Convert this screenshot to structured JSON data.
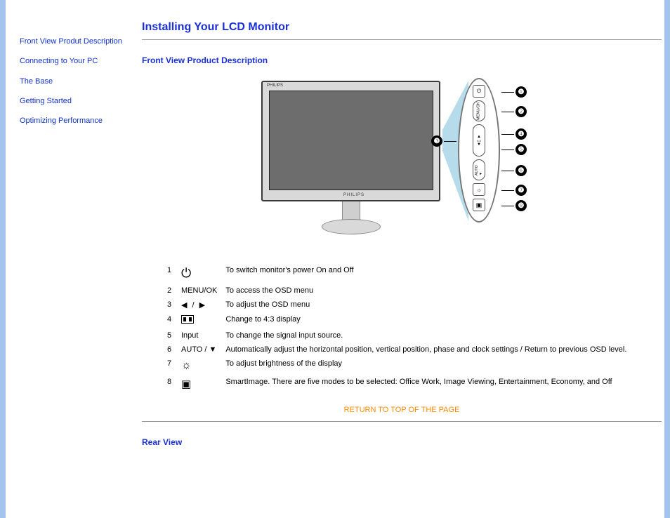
{
  "sidebar": {
    "items": [
      {
        "label": "Front View Produt Description"
      },
      {
        "label": "Connecting to Your PC"
      },
      {
        "label": "The Base"
      },
      {
        "label": "Getting Started"
      },
      {
        "label": "Optimizing Performance"
      }
    ]
  },
  "page": {
    "title": "Installing Your LCD Monitor",
    "section1": "Front View Product Description",
    "section2": "Rear View",
    "returnTop": "RETURN TO TOP OF THE PAGE"
  },
  "monitor": {
    "brand": "PHILIPS",
    "brand2": "PHILIPS",
    "panelButtons": [
      {
        "glyph": "⏻",
        "kind": "icon"
      },
      {
        "glyph": "MENU/OK",
        "kind": "rot"
      },
      {
        "glyph": "▲\n▼",
        "kind": "mid"
      },
      {
        "glyph": "AUTO",
        "kind": "rot2"
      },
      {
        "glyph": "☉",
        "kind": "icon"
      },
      {
        "glyph": "▣",
        "kind": "icon"
      }
    ],
    "callouts": [
      "1",
      "2",
      "3",
      "4",
      "5",
      "6",
      "7",
      "8"
    ]
  },
  "funcs": [
    {
      "n": "1",
      "icon": "power",
      "label": "",
      "desc": "To switch monitor's power On and Off"
    },
    {
      "n": "2",
      "icon": "text",
      "label": "MENU/OK",
      "desc": "To access the OSD menu"
    },
    {
      "n": "3",
      "icon": "tri",
      "label": "◀ / ▶",
      "desc": "To adjust the OSD menu"
    },
    {
      "n": "4",
      "icon": "box",
      "label": "",
      "desc": "Change to 4:3 display"
    },
    {
      "n": "5",
      "icon": "text",
      "label": "Input",
      "desc": "To change the signal input source."
    },
    {
      "n": "6",
      "icon": "text",
      "label": "AUTO / ▼",
      "desc": "Automatically adjust the horizontal position, vertical position, phase and clock settings / Return to previous OSD level."
    },
    {
      "n": "7",
      "icon": "sun",
      "label": "",
      "desc": "To adjust brightness of the display"
    },
    {
      "n": "8",
      "icon": "smart",
      "label": "",
      "desc": "SmartImage. There are five modes to be selected: Office Work, Image Viewing, Entertainment, Economy, and Off"
    }
  ]
}
